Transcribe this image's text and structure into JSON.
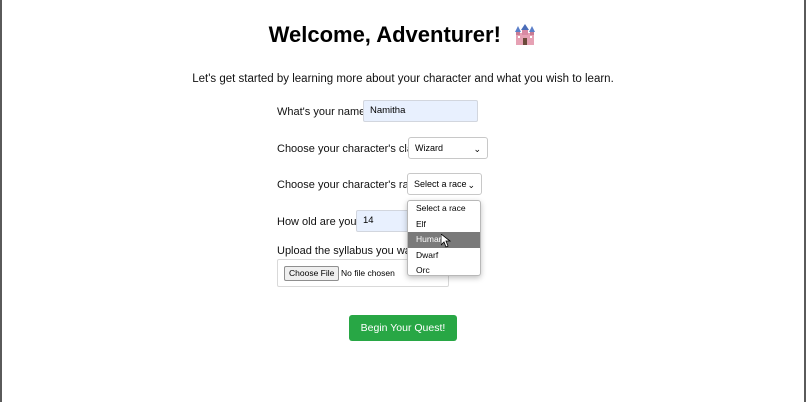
{
  "page": {
    "title": "Welcome, Adventurer!",
    "title_icon": "castle-icon",
    "intro": "Let's get started by learning more about your character and what you wish to learn."
  },
  "form": {
    "name_label": "What's your name?",
    "name_value": "Namitha",
    "class_label": "Choose your character's class:",
    "class_value": "Wizard",
    "race_label": "Choose your character's race:",
    "race_value": "Select a race",
    "race_options": [
      "Select a race",
      "Elf",
      "Human",
      "Dwarf",
      "Orc"
    ],
    "race_highlighted": "Human",
    "age_label": "How old are you?",
    "age_value": "14",
    "upload_label": "Upload the syllabus you want",
    "file_button_label": "Choose File",
    "file_status": "No file chosen",
    "submit_label": "Begin Your Quest!"
  },
  "colors": {
    "submit_button": "#28a745",
    "autofill_bg": "#e8f0fe",
    "dropdown_highlight": "#7a7a7a"
  }
}
